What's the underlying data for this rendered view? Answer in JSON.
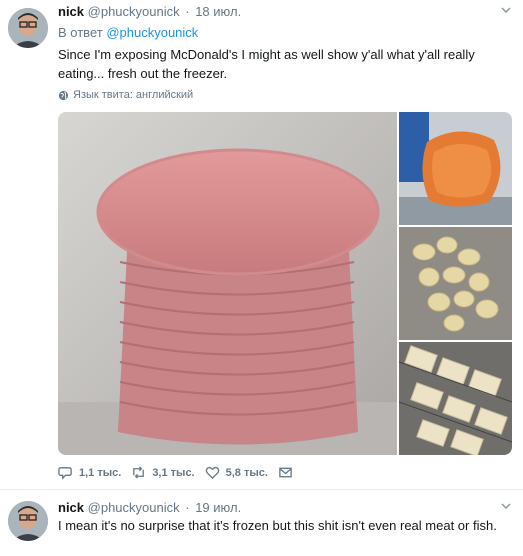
{
  "tweets": [
    {
      "name": "nick",
      "handle": "@phuckyounick",
      "dot": "·",
      "time": "18 июл.",
      "reply_prefix": "В ответ",
      "reply_handle": "@phuckyounick",
      "text": "Since I'm exposing McDonald's I might as well show y'all what y'all really eating... fresh out the freezer.",
      "translate_label": "Язык твита: английский",
      "actions": {
        "replies": "1,1 тыс.",
        "retweets": "3,1 тыс.",
        "likes": "5,8 тыс."
      },
      "icons": {
        "reply": "reply-icon",
        "retweet": "retweet-icon",
        "like": "heart-icon",
        "dm": "envelope-icon",
        "translate": "globe-icon",
        "menu": "chevron-down-icon"
      }
    },
    {
      "name": "nick",
      "handle": "@phuckyounick",
      "dot": "·",
      "time": "19 июл.",
      "text": "I mean it's no surprise that it's frozen but this shit isn't even real meat or fish."
    }
  ],
  "colors": {
    "link": "#1b95e0",
    "secondary_text": "#657786",
    "primary_text": "#14171a",
    "divider": "#e6ecf0"
  }
}
